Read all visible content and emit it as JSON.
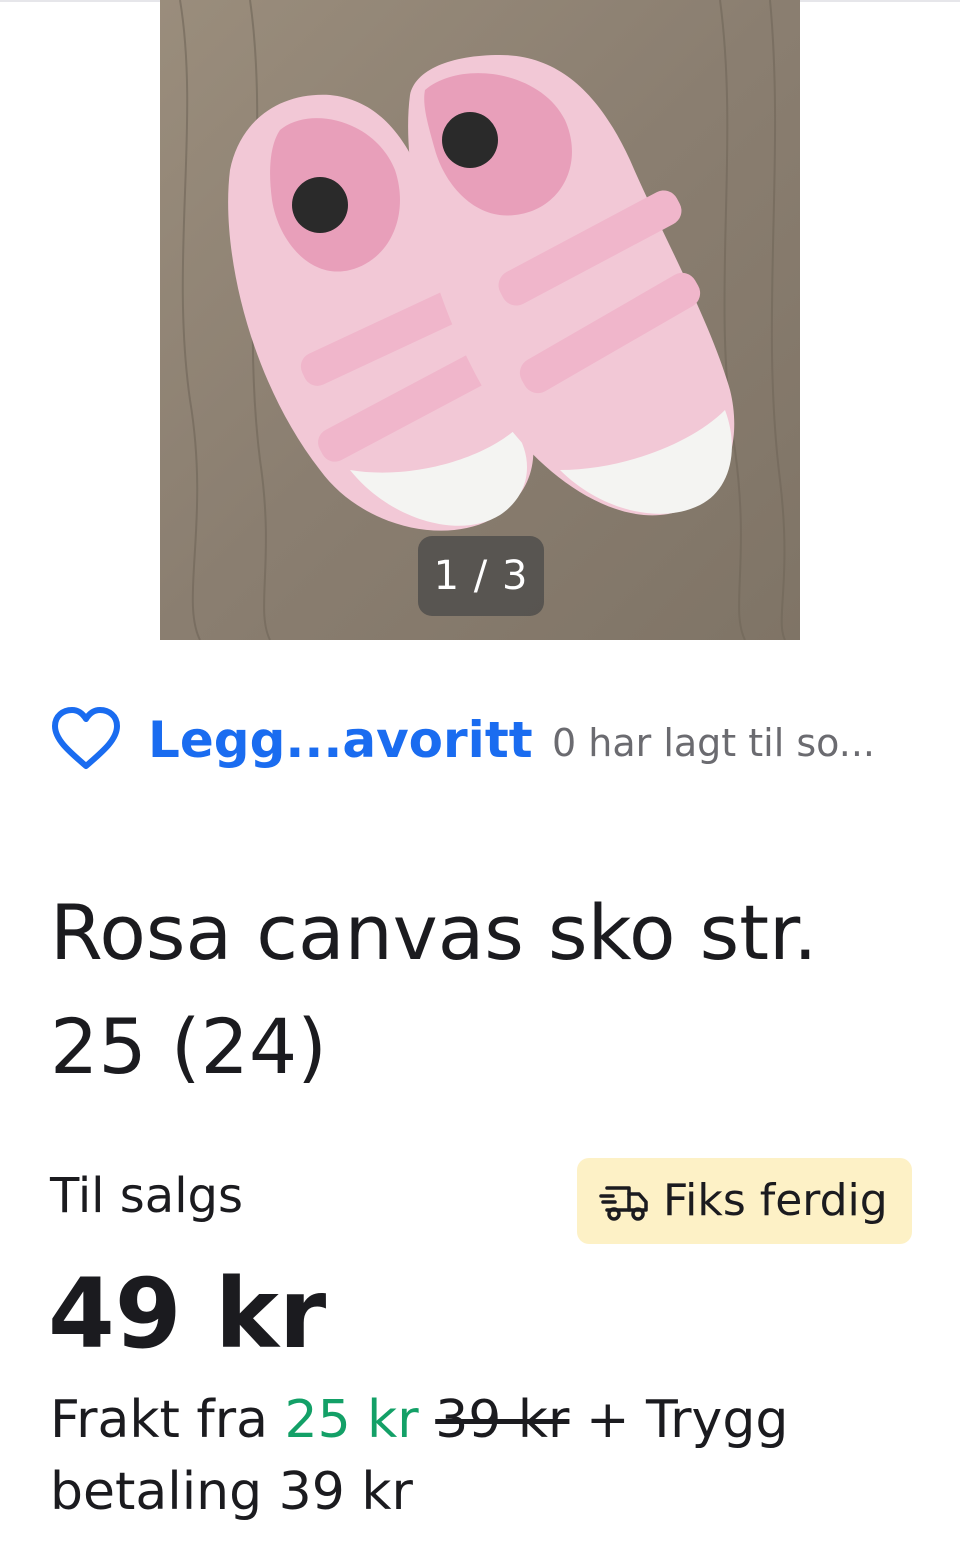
{
  "gallery": {
    "counter": "1 / 3",
    "image_description": "Pink canvas children's shoes with velcro straps on wooden floor"
  },
  "favorite": {
    "icon": "heart-outline-icon",
    "label": "Legg...avoritt",
    "count_text": "0 har lagt til so..."
  },
  "listing": {
    "title": "Rosa canvas sko str. 25 (24)",
    "status": "Til salgs",
    "badge": {
      "icon": "truck-icon",
      "label": "Fiks ferdig"
    },
    "price": "49 kr"
  },
  "shipping": {
    "prefix": "Frakt fra",
    "discounted_price": "25 kr",
    "original_price": "39 kr",
    "suffix": "+ Trygg betaling 39 kr"
  },
  "colors": {
    "accent_blue": "#1a6cf0",
    "price_green": "#13a067",
    "badge_bg": "#fdf1c6"
  }
}
